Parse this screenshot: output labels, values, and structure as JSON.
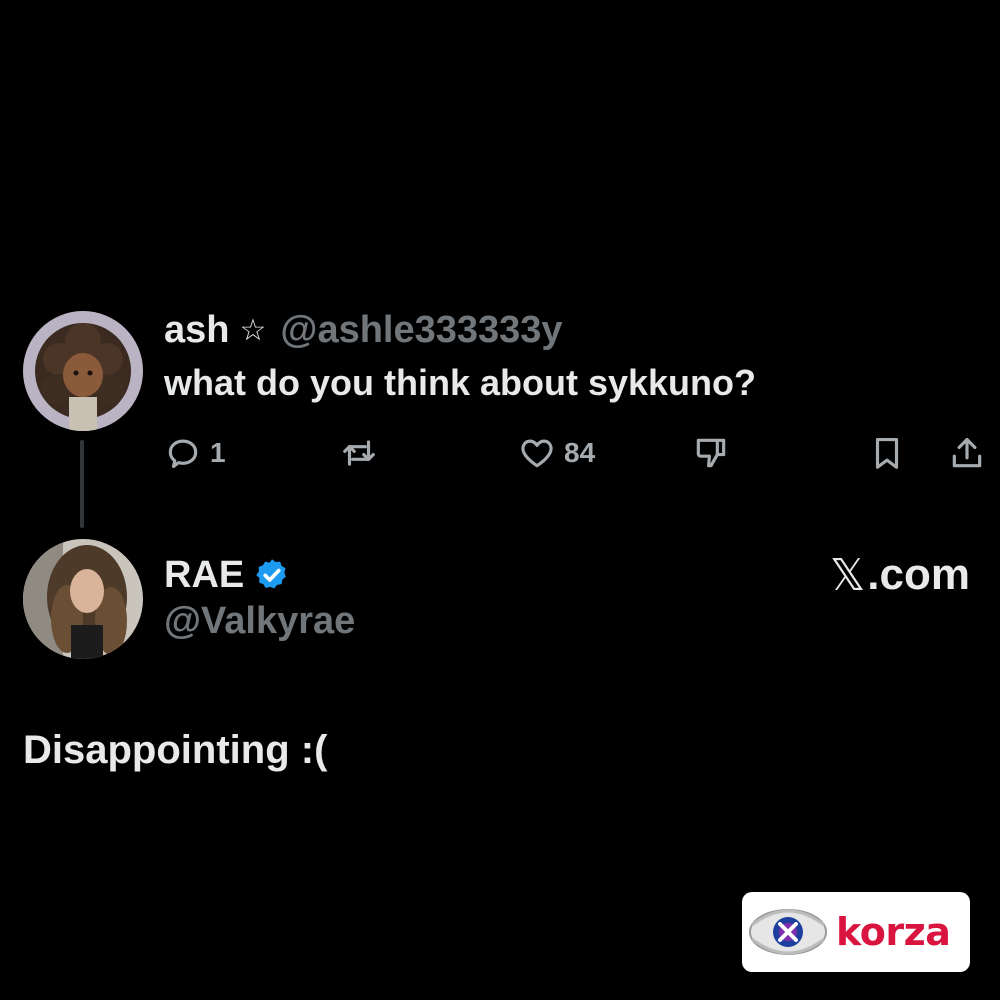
{
  "parent_tweet": {
    "display_name": "ash",
    "badge_symbol": "☆",
    "handle": "@ashle333333y",
    "text": "what do you think about sykkuno?",
    "avatar_icon": "curly-hair-cartoon-avatar",
    "actions": {
      "reply": {
        "icon": "reply-bubble-icon",
        "count": "1"
      },
      "repost": {
        "icon": "repost-icon"
      },
      "like": {
        "icon": "heart-icon",
        "count": "84"
      },
      "dislike": {
        "icon": "thumbs-down-icon"
      },
      "bookmark": {
        "icon": "bookmark-icon"
      },
      "share": {
        "icon": "share-icon"
      }
    }
  },
  "reply_tweet": {
    "display_name": "RAE",
    "handle": "@Valkyrae",
    "verified_icon": "verified-badge-icon",
    "avatar_icon": "photo-avatar",
    "text": "Disappointing :("
  },
  "site_label": {
    "x_glyph": "𝕏",
    "domain": ".com"
  },
  "watermark": {
    "text": "korza",
    "icon": "eye-logo-icon"
  },
  "colors": {
    "background": "#000000",
    "text_primary": "#e7e9ea",
    "text_secondary": "#71767b",
    "verified_blue": "#1d9bf0",
    "watermark_red": "#d9143f"
  }
}
